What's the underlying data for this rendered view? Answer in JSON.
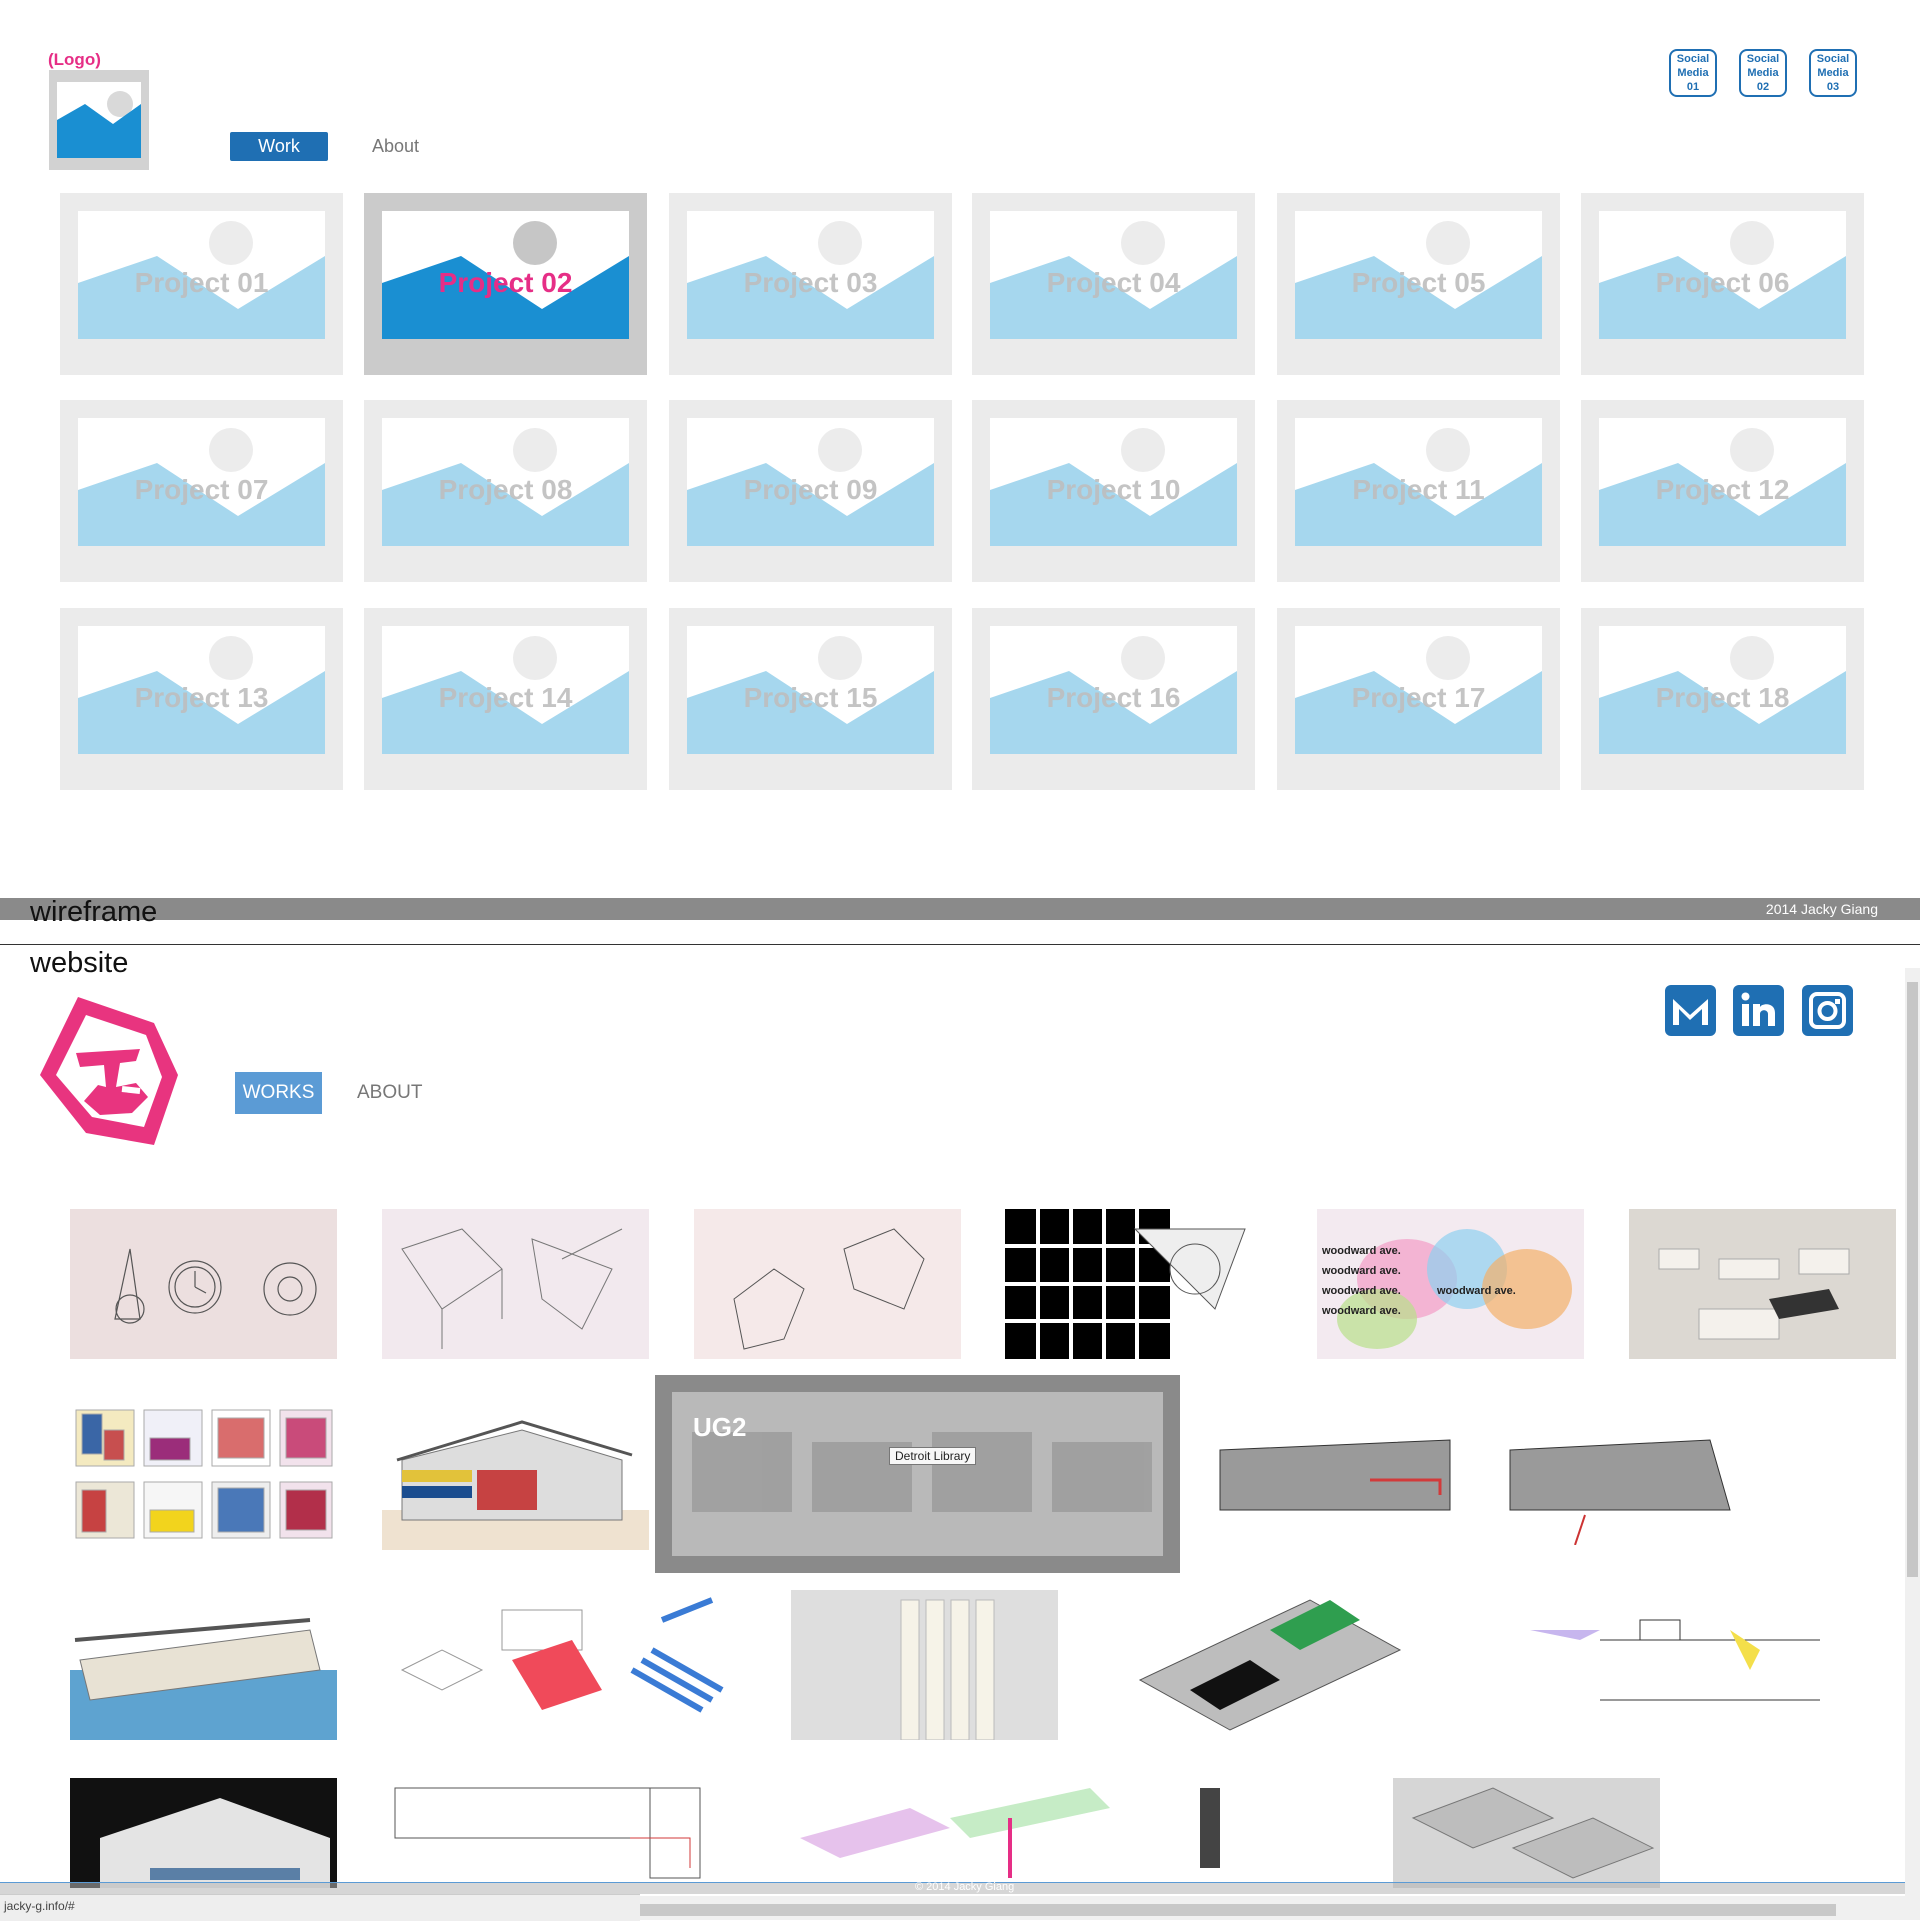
{
  "wireframe": {
    "logo_text": "(Logo)",
    "social": [
      "Social\nMedia\n01",
      "Social\nMedia\n02",
      "Social\nMedia\n03"
    ],
    "nav": {
      "work": "Work",
      "about": "About"
    },
    "projects": [
      "Project 01",
      "Project 02",
      "Project 03",
      "Project 04",
      "Project 05",
      "Project 06",
      "Project 07",
      "Project 08",
      "Project 09",
      "Project 10",
      "Project 11",
      "Project 12",
      "Project 13",
      "Project 14",
      "Project 15",
      "Project 16",
      "Project 17",
      "Project 18"
    ],
    "active_project": "Project 02",
    "footer": "2014 Jacky Giang"
  },
  "labels": {
    "wireframe": "wireframe",
    "website": "website"
  },
  "website": {
    "nav": {
      "works": "WORKS",
      "about": "ABOUT"
    },
    "social_icons": [
      "mail-icon",
      "linkedin-icon",
      "instagram-icon"
    ],
    "hover": {
      "title": "UG2",
      "tooltip": "Detroit Library"
    },
    "footer": "© 2014 Jacky Giang"
  },
  "browser": {
    "status_url": "jacky-g.info/#"
  },
  "colors": {
    "accent_blue": "#1f6fb3",
    "accent_pink": "#e62e86",
    "works_blue": "#5b9bd5"
  }
}
